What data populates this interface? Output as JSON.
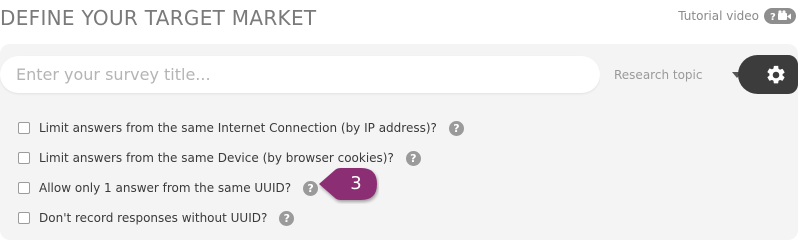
{
  "header": {
    "title": "DEFINE YOUR TARGET MARKET",
    "tutorial_label": "Tutorial video"
  },
  "survey": {
    "placeholder": "Enter your survey title...",
    "topic_label": "Research topic"
  },
  "options": [
    {
      "label": "Limit answers from the same Internet Connection (by IP address)?",
      "checked": false
    },
    {
      "label": "Limit answers from the same Device (by browser cookies)?",
      "checked": false
    },
    {
      "label": "Allow only 1 answer from the same UUID?",
      "checked": false
    },
    {
      "label": "Don't record responses without UUID?",
      "checked": false
    }
  ],
  "help_glyph": "?",
  "callout": {
    "number": "3",
    "color": "#8b2f73"
  },
  "icons": [
    "video-help-icon",
    "chevron-down-icon",
    "gear-icon",
    "help-icon"
  ]
}
